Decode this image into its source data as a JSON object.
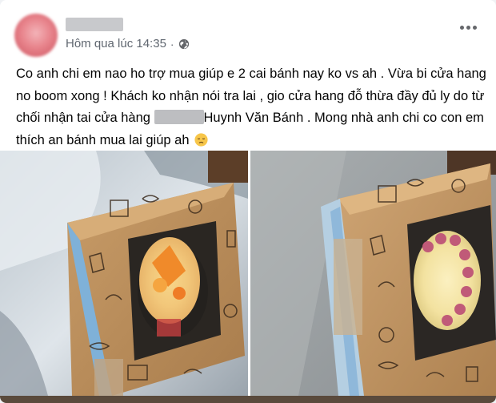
{
  "post": {
    "author_name": "",
    "timestamp": "Hôm qua lúc 14:35",
    "separator": "·",
    "privacy_icon": "globe-icon",
    "menu_icon": "more-options-icon",
    "text_part1": "Co anh chi em nao ho trợ mua giúp e 2 cai bánh nay ko vs ah . Vừa bi cửa hang no boom xong ! Khách ko nhận nói tra lai , gio cửa hang đỗ thừa đầy đủ ly do từ chối nhận tai cửa hàng ",
    "text_part2": "Huynh Văn Bánh . Mong nhà anh chi co con em thích an bánh mua lai giúp ah",
    "emoji_icon": "disappointed-face-icon"
  },
  "photos": [
    {
      "name": "cake-box-photo-1",
      "content": "cake-in-kraft-box-icon"
    },
    {
      "name": "cake-box-photo-2",
      "content": "cake-in-kraft-box-icon"
    }
  ],
  "colors": {
    "meta_text": "#606770",
    "text": "#050505",
    "background": "#ffffff",
    "box_kraft": "#c9a070"
  }
}
